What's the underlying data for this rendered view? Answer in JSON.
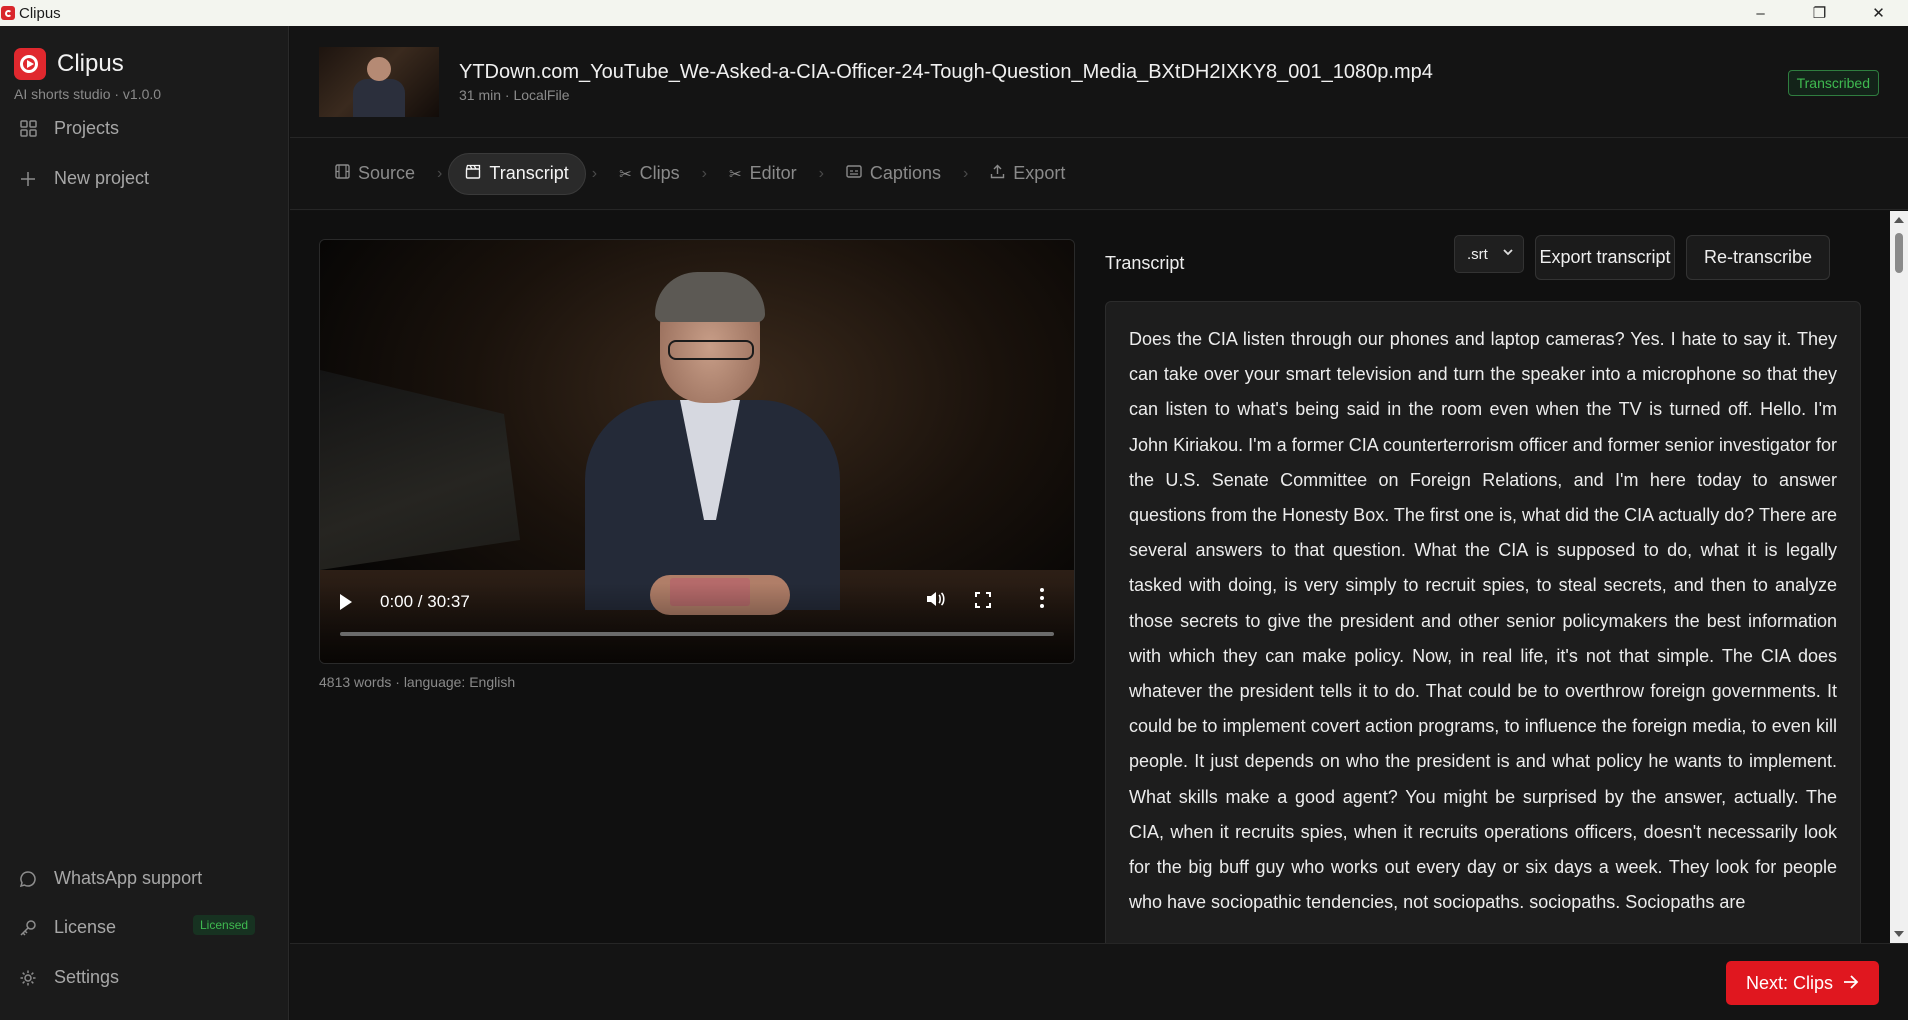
{
  "window": {
    "title": "Clipus",
    "controls": [
      "–",
      "❐",
      "✕"
    ]
  },
  "sidebar": {
    "brand_name": "Clipus",
    "brand_sub": "AI shorts studio · v1.0.0",
    "items": [
      {
        "label": "Projects",
        "icon": "grid-icon"
      },
      {
        "label": "New project",
        "icon": "plus-icon"
      }
    ],
    "bottom_items": [
      {
        "label": "WhatsApp support",
        "icon": "chat-bubble-icon"
      },
      {
        "label": "License",
        "icon": "key-icon",
        "badge": "Licensed"
      },
      {
        "label": "Settings",
        "icon": "gear-icon"
      }
    ]
  },
  "header": {
    "file_title": "YTDown.com_YouTube_We-Asked-a-CIA-Officer-24-Tough-Question_Media_BXtDH2IXKY8_001_1080p.mp4",
    "file_meta": "31 min · LocalFile",
    "status": "Transcribed"
  },
  "steps": [
    {
      "label": "Source",
      "icon": "film-icon",
      "active": false
    },
    {
      "label": "Transcript",
      "icon": "clapper-icon",
      "active": true
    },
    {
      "label": "Clips",
      "icon": "scissors-icon",
      "active": false
    },
    {
      "label": "Editor",
      "icon": "scissors-icon",
      "active": false
    },
    {
      "label": "Captions",
      "icon": "captions-icon",
      "active": false
    },
    {
      "label": "Export",
      "icon": "upload-icon",
      "active": false
    }
  ],
  "video": {
    "time": "0:00 / 30:37",
    "progress": 0,
    "meta": "4813 words · language: English"
  },
  "transcript": {
    "label": "Transcript",
    "format_selected": ".srt",
    "export_label": "Export transcript",
    "retranscribe_label": "Re-transcribe",
    "text": "Does the CIA listen through our phones and laptop cameras? Yes. I hate to say it. They can take over your smart television and turn the speaker into a microphone so that they can listen to what's being said in the room even when the TV is turned off. Hello. I'm John Kiriakou. I'm a former CIA counterterrorism officer and former senior investigator for the U.S. Senate Committee on Foreign Relations, and I'm here today to answer questions from the Honesty Box. The first one is, what did the CIA actually do? There are several answers to that question. What the CIA is supposed to do, what it is legally tasked with doing, is very simply to recruit spies, to steal secrets, and then to analyze those secrets to give the president and other senior policymakers the best information with which they can make policy. Now, in real life, it's not that simple. The CIA does whatever the president tells it to do. That could be to overthrow foreign governments. It could be to implement covert action programs, to influence the foreign media, to even kill people. It just depends on who the president is and what policy he wants to implement. What skills make a good agent? You might be surprised by the answer, actually. The CIA, when it recruits spies, when it recruits operations officers, doesn't necessarily look for the big buff guy who works out every day or six days a week. They look for people who have sociopathic tendencies, not sociopaths. sociopaths. Sociopaths are"
  },
  "footer": {
    "next_label": "Next: Clips",
    "next_icon": "arrow-right-icon"
  },
  "colors": {
    "accent": "#e0171f",
    "success": "#3fb950"
  }
}
